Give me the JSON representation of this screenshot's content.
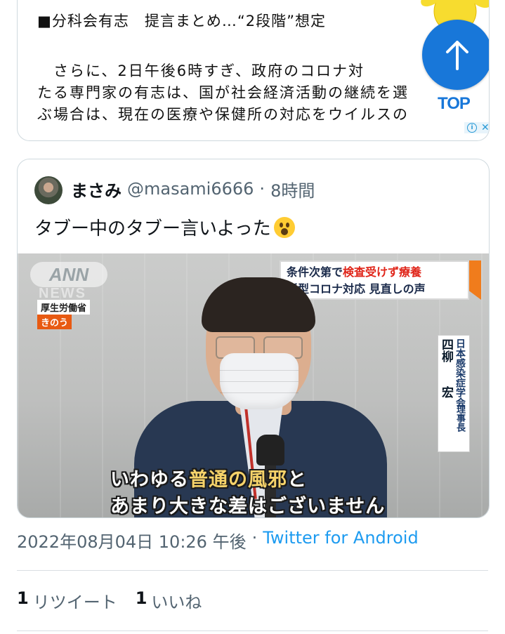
{
  "article": {
    "heading": "■分科会有志　提言まとめ…“2段階”想定",
    "body_lines": [
      "　さらに、2日午後6時すぎ、政府のコロナ対",
      "たる専門家の有志は、国が社会経済活動の継続を選",
      "ぶ場合は、現在の医療や保健所の対応をウイルスの"
    ],
    "top_button_label": "TOP",
    "top_button_icon": "arrow-up-icon",
    "ad_info_icon": "info-icon",
    "ad_close_icon": "close-icon"
  },
  "quote": {
    "name": "まさみ",
    "handle": "@masami6666",
    "separator": "·",
    "time": "8時間",
    "text": "タブー中のタブー言いよった",
    "emoji": "astonished-face-icon",
    "media": {
      "logo_text": "ANN",
      "logo_sub": "NEWS",
      "ministry": "厚生労働省",
      "when": "きのう",
      "headline_part1": "条件次第で",
      "headline_accent": "検査受けず療養",
      "headline_line2": "新型コロナ対応 見直しの声",
      "nameplate": {
        "org": "日本感染症学会",
        "surname": "四柳",
        "given": "宏",
        "title": "理事長"
      },
      "caption_line1_a": "いわゆる",
      "caption_line1_b": "普通の風邪",
      "caption_line1_c": "と",
      "caption_line2": "あまり大きな差はございません"
    }
  },
  "timestamp": "2022年08月04日 10:26 午後",
  "timestamp_sep": "·",
  "client": "Twitter for Android",
  "stats": {
    "retweets_count": "1",
    "retweets_label": "リツイート",
    "likes_count": "1",
    "likes_label": "いいね"
  },
  "colors": {
    "accent": "#1d9bf0",
    "top_button": "#1877d9",
    "muted": "#536471"
  }
}
